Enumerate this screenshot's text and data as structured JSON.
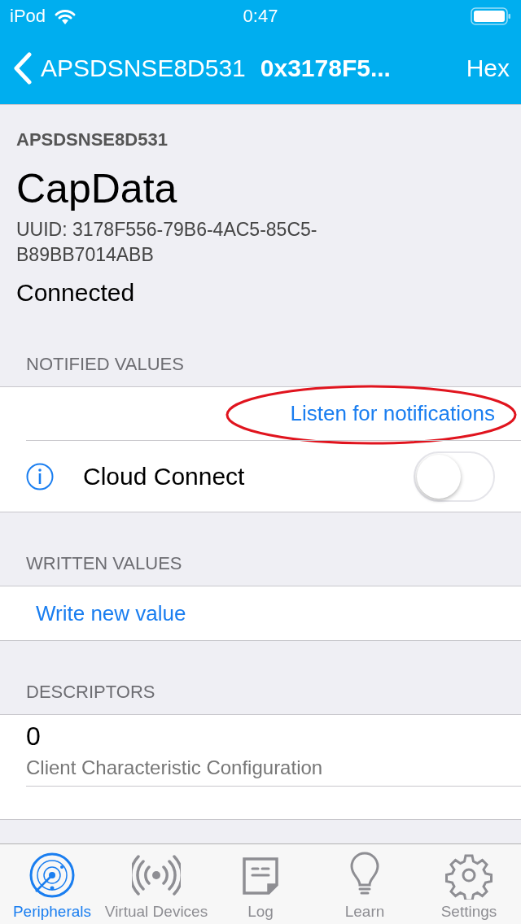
{
  "status_bar": {
    "carrier": "iPod",
    "time": "0:47"
  },
  "nav_bar": {
    "back_label": "APSDSNSE8D531",
    "title": "0x3178F5...",
    "action": "Hex"
  },
  "characteristic": {
    "device": "APSDSNSE8D531",
    "name": "CapData",
    "uuid": "UUID: 3178F556-79B6-4AC5-85C5-B89BB7014ABB",
    "status": "Connected"
  },
  "notified_values": {
    "header": "NOTIFIED VALUES",
    "listen_link": "Listen for notifications",
    "cloud_connect": {
      "label": "Cloud Connect",
      "on": false
    }
  },
  "written_values": {
    "header": "WRITTEN VALUES",
    "write_link": "Write new value"
  },
  "descriptors": {
    "header": "DESCRIPTORS",
    "items": [
      {
        "value": "0",
        "name": "Client Characteristic Configuration"
      }
    ]
  },
  "tabs": [
    {
      "label": "Peripherals",
      "kind": "radar",
      "selected": true
    },
    {
      "label": "Virtual Devices",
      "kind": "broadcast",
      "selected": false
    },
    {
      "label": "Log",
      "kind": "note",
      "selected": false
    },
    {
      "label": "Learn",
      "kind": "bulb",
      "selected": false
    },
    {
      "label": "Settings",
      "kind": "gear",
      "selected": false
    }
  ]
}
